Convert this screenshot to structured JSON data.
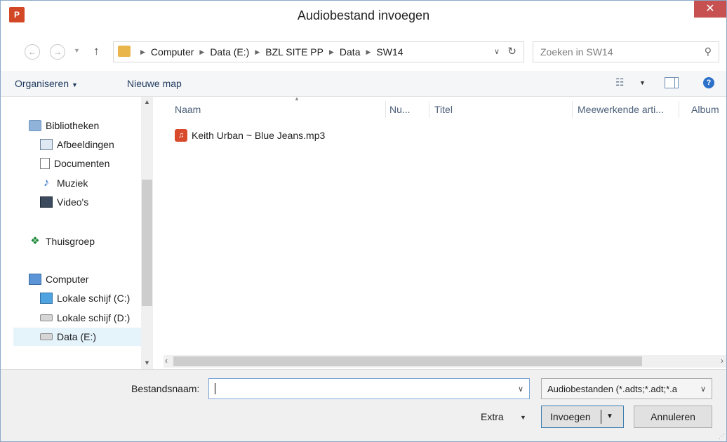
{
  "window": {
    "title": "Audiobestand invoegen",
    "app_icon_text": "P",
    "close_glyph": "✕"
  },
  "nav": {
    "back_glyph": "←",
    "forward_glyph": "→",
    "up_glyph": "↑",
    "breadcrumbs": [
      "Computer",
      "Data (E:)",
      "BZL SITE PP",
      "Data",
      "SW14"
    ],
    "search_placeholder": "Zoeken in SW14"
  },
  "toolbar": {
    "organize_label": "Organiseren",
    "new_folder_label": "Nieuwe map"
  },
  "tree": [
    {
      "label": "Bibliotheken",
      "icon": "library-icon"
    },
    {
      "label": "Afbeeldingen",
      "icon": "pictures-icon"
    },
    {
      "label": "Documenten",
      "icon": "documents-icon"
    },
    {
      "label": "Muziek",
      "icon": "music-icon"
    },
    {
      "label": "Video's",
      "icon": "video-icon"
    },
    {
      "label": "Thuisgroep",
      "icon": "homegroup-icon"
    },
    {
      "label": "Computer",
      "icon": "computer-icon"
    },
    {
      "label": "Lokale schijf (C:)",
      "icon": "system-drive-icon"
    },
    {
      "label": "Lokale schijf (D:)",
      "icon": "drive-icon"
    },
    {
      "label": "Data (E:)",
      "icon": "drive-icon",
      "selected": true
    }
  ],
  "columns": {
    "name": "Naam",
    "number": "Nu...",
    "title": "Titel",
    "artists": "Meewerkende arti...",
    "album": "Album"
  },
  "files": [
    {
      "name": "Keith Urban ~ Blue Jeans.mp3",
      "icon": "audio-file-icon"
    }
  ],
  "bottom": {
    "filename_label": "Bestandsnaam:",
    "filename_value": "",
    "filetype_value": "Audiobestanden (*.adts;*.adt;*.a",
    "tools_label": "Extra",
    "insert_label": "Invoegen",
    "cancel_label": "Annuleren"
  }
}
